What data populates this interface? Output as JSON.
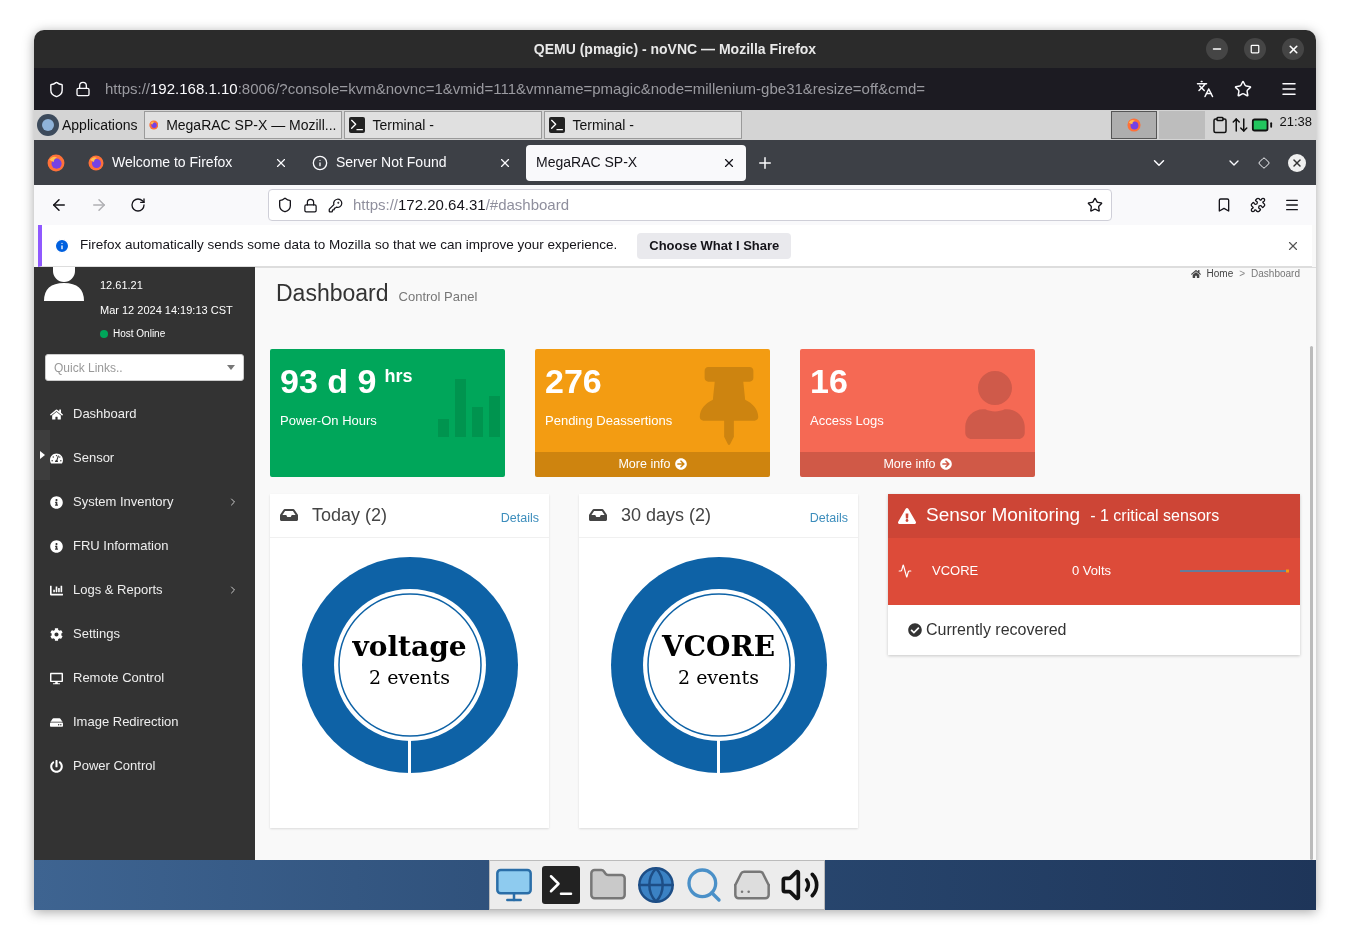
{
  "window": {
    "title": "QEMU (pmagic) - noVNC — Mozilla Firefox"
  },
  "novnc_address": {
    "scheme": "https://",
    "host": "192.168.1.10",
    "rest": ":8006/?console=kvm&novnc=1&vmid=111&vmname=pmagic&node=millenium-gbe31&resize=off&cmd="
  },
  "panel": {
    "menu": "Applications",
    "tasks": [
      {
        "kind": "browser",
        "label": "MegaRAC SP-X — Mozill..."
      },
      {
        "kind": "terminal",
        "label": "Terminal -"
      },
      {
        "kind": "terminal",
        "label": "Terminal -"
      }
    ],
    "workspaces": [
      {
        "selected": true
      },
      {
        "selected": false
      }
    ],
    "clock": "21:38"
  },
  "browser": {
    "tabs": [
      {
        "kind": "firefox",
        "label": "Welcome to Firefox",
        "selected": false
      },
      {
        "kind": "info",
        "label": "Server Not Found",
        "selected": false
      },
      {
        "kind": "none",
        "label": "MegaRAC SP-X",
        "selected": true
      }
    ],
    "address": {
      "scheme": "https://",
      "host": "172.20.64.31",
      "rest": "/#dashboard"
    },
    "notice": {
      "text": "Firefox automatically sends some data to Mozilla so that we can improve your experience.",
      "button": "Choose What I Share"
    }
  },
  "sidebar": {
    "version": "12.61.21",
    "datetime": "Mar 12 2024 14:19:13 CST",
    "host_status": "Host Online",
    "quick_links": {
      "placeholder": "Quick Links.."
    },
    "items": [
      {
        "kind": "home",
        "label": "Dashboard",
        "submenu": false
      },
      {
        "kind": "gauge",
        "label": "Sensor",
        "submenu": false
      },
      {
        "kind": "info",
        "label": "System Inventory",
        "submenu": true
      },
      {
        "kind": "info",
        "label": "FRU Information",
        "submenu": false
      },
      {
        "kind": "chart",
        "label": "Logs & Reports",
        "submenu": true
      },
      {
        "kind": "gear",
        "label": "Settings",
        "submenu": false
      },
      {
        "kind": "monitor",
        "label": "Remote Control",
        "submenu": false
      },
      {
        "kind": "drive",
        "label": "Image Redirection",
        "submenu": false
      },
      {
        "kind": "power",
        "label": "Power Control",
        "submenu": false
      }
    ]
  },
  "main": {
    "title": "Dashboard",
    "subtitle": "Control Panel",
    "breadcrumb": [
      "Home",
      "Dashboard"
    ],
    "breadcrumb_separator": ">",
    "tiles": [
      {
        "kind": "bars",
        "value": "93 d 9",
        "unit": "hrs",
        "label": "Power-On Hours",
        "color": "#00a65a"
      },
      {
        "kind": "pin",
        "value": "276",
        "label": "Pending Deassertions",
        "color": "#f39c12",
        "link": "More info"
      },
      {
        "kind": "user",
        "value": "16",
        "label": "Access Logs",
        "color": "#f56954",
        "link": "More info"
      }
    ],
    "event_panels": [
      {
        "title": "Today (2)",
        "link": "Details",
        "center": "voltage",
        "sub": "2 events"
      },
      {
        "title": "30 days (2)",
        "link": "Details",
        "center": "VCORE",
        "sub": "2 events"
      }
    ],
    "sensor_monitoring": {
      "title": "Sensor Monitoring",
      "count": "- 1 critical sensors",
      "sensors": [
        {
          "name": "VCORE",
          "reading": "0 Volts"
        }
      ],
      "footer": "Currently recovered"
    }
  }
}
